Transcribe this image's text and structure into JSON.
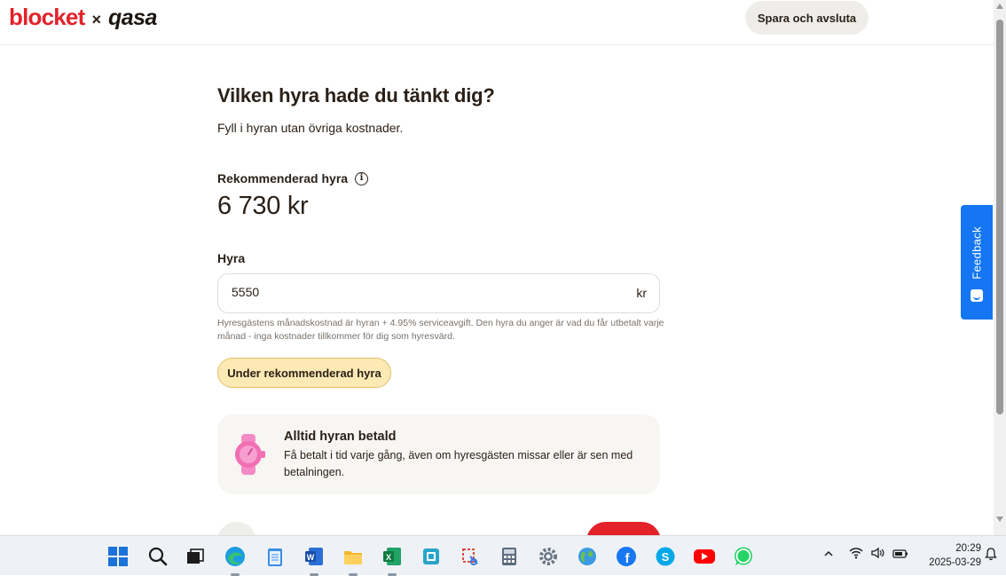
{
  "header": {
    "logo_left": "blocket",
    "logo_sep": "×",
    "logo_right": "qasa",
    "save_button": "Spara och avsluta"
  },
  "main": {
    "title": "Vilken hyra hade du tänkt dig?",
    "subtitle": "Fyll i hyran utan övriga kostnader.",
    "recommended_label": "Rekommenderad hyra",
    "recommended_value": "6 730 kr",
    "rent_label": "Hyra",
    "rent_value": "5550",
    "rent_suffix": "kr",
    "help_text": "Hyresgästens månadskostnad är hyran + 4.95% serviceavgift. Den hyra du anger är vad du får utbetalt varje månad - inga kostnader tillkommer för dig som hyresvärd.",
    "badge": "Under rekommenderad hyra",
    "promo_title": "Alltid hyran betald",
    "promo_text": "Få betalt i tid varje gång, även om hyresgästen missar eller är sen med betalningen."
  },
  "feedback": {
    "label": "Feedback"
  },
  "taskbar": {
    "apps": [
      "windows-start",
      "search",
      "task-view",
      "edge",
      "notepad",
      "word",
      "file-explorer",
      "excel",
      "outlook",
      "snipping-tool",
      "calculator",
      "settings",
      "maps",
      "facebook",
      "skype",
      "youtube",
      "whatsapp"
    ],
    "time": "20:29",
    "date": "2025-03-29"
  },
  "colors": {
    "brand_red": "#e3222a",
    "badge_bg": "#fde9b4",
    "feedback_blue": "#1476f2"
  }
}
